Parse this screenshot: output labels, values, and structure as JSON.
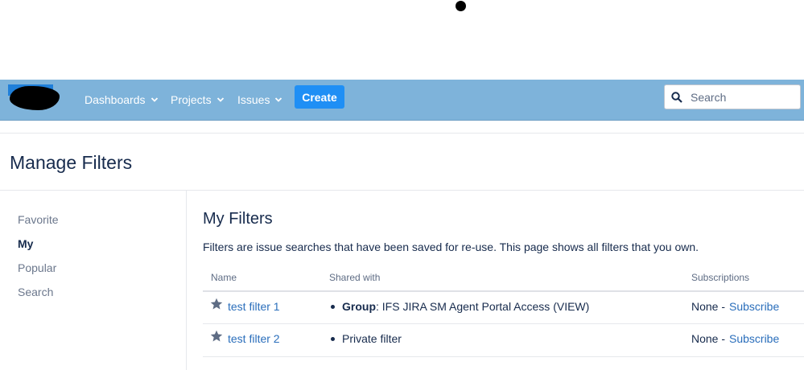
{
  "header": {
    "nav": [
      {
        "label": "Dashboards"
      },
      {
        "label": "Projects"
      },
      {
        "label": "Issues"
      }
    ],
    "create_label": "Create",
    "search_placeholder": "Search"
  },
  "page": {
    "title": "Manage Filters"
  },
  "sidebar": {
    "items": [
      {
        "label": "Favorite",
        "active": false
      },
      {
        "label": "My",
        "active": true
      },
      {
        "label": "Popular",
        "active": false
      },
      {
        "label": "Search",
        "active": false
      }
    ]
  },
  "main": {
    "title": "My Filters",
    "description": "Filters are issue searches that have been saved for re-use. This page shows all filters that you own.",
    "columns": [
      "Name",
      "Shared with",
      "Subscriptions"
    ],
    "rows": [
      {
        "name": "test filter 1",
        "shared_bold": "Group",
        "shared_rest": ": IFS JIRA SM Agent Portal Access (VIEW)",
        "subs_none": "None -",
        "subs_link": "Subscribe"
      },
      {
        "name": "test filter 2",
        "shared_bold": "",
        "shared_rest": "Private filter",
        "subs_none": "None -",
        "subs_link": "Subscribe"
      }
    ]
  },
  "colors": {
    "topbar": "#7eb3da",
    "create_button": "#1f8ff5",
    "link": "#2a6ebb",
    "text": "#172b4d"
  },
  "icons": [
    "chevron-down-icon",
    "search-icon",
    "star-icon"
  ]
}
